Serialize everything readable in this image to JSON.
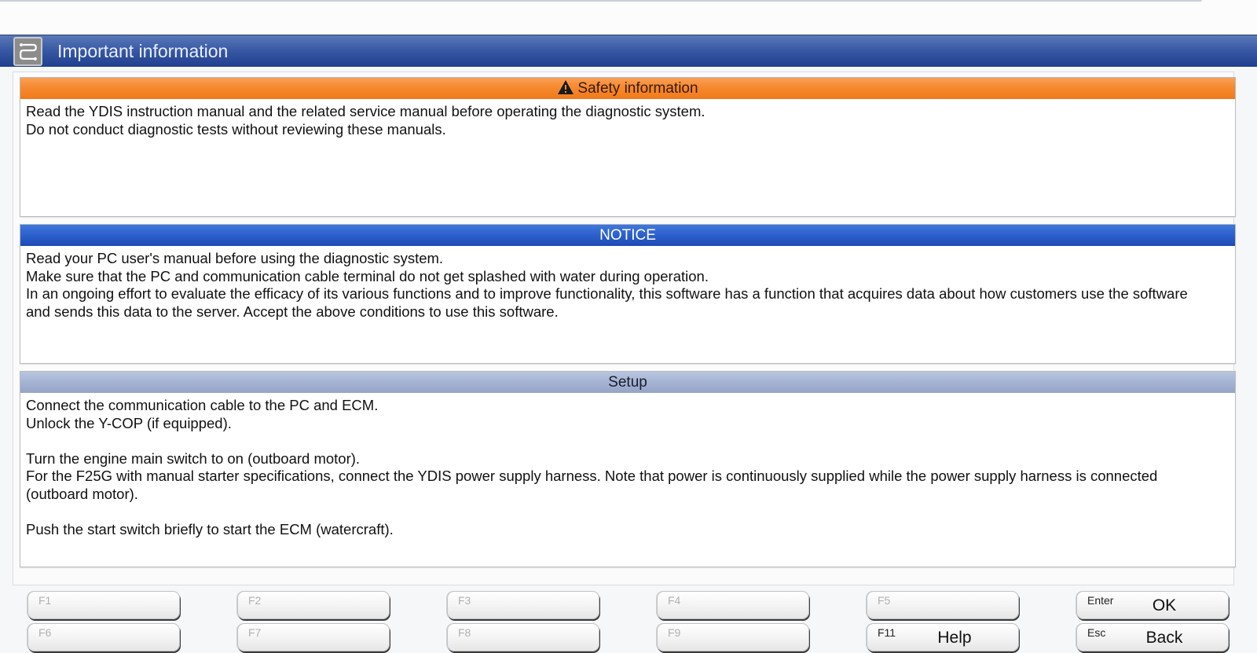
{
  "window": {
    "title": "Important information",
    "icon": "app-logo-icon"
  },
  "panels": {
    "safety": {
      "header": "Safety information",
      "header_icon": "warning-triangle-icon",
      "color": "#f58a2e",
      "lines": [
        "Read the YDIS instruction manual and the related service manual before operating the diagnostic system.",
        "Do not conduct diagnostic tests without reviewing these manuals."
      ]
    },
    "notice": {
      "header": "NOTICE",
      "color": "#2c5fcb",
      "lines": [
        "Read your PC user's manual before using the diagnostic system.",
        "Make sure that the PC and communication cable terminal do not get splashed with water during operation.",
        "In an ongoing effort to evaluate the efficacy of its various functions and to improve functionality, this software has a function that acquires data about how customers use the software and sends this data to the server. Accept the above conditions to use this software."
      ]
    },
    "setup": {
      "header": "Setup",
      "color": "#a5b3d3",
      "lines": [
        "Connect the communication cable to the PC and ECM.",
        "Unlock the Y-COP (if equipped).",
        "",
        "Turn the engine main switch to on (outboard motor).",
        "For the F25G with manual starter specifications, connect the YDIS power supply harness. Note that power is continuously supplied while the power supply harness is connected (outboard motor).",
        "",
        "Push the start switch briefly to start the ECM (watercraft)."
      ]
    }
  },
  "function_keys": [
    {
      "key": "F1",
      "label": "",
      "enabled": false
    },
    {
      "key": "F2",
      "label": "",
      "enabled": false
    },
    {
      "key": "F3",
      "label": "",
      "enabled": false
    },
    {
      "key": "F4",
      "label": "",
      "enabled": false
    },
    {
      "key": "F5",
      "label": "",
      "enabled": false
    },
    {
      "key": "Enter",
      "label": "OK",
      "enabled": true
    },
    {
      "key": "F6",
      "label": "",
      "enabled": false
    },
    {
      "key": "F7",
      "label": "",
      "enabled": false
    },
    {
      "key": "F8",
      "label": "",
      "enabled": false
    },
    {
      "key": "F9",
      "label": "",
      "enabled": false
    },
    {
      "key": "F11",
      "label": "Help",
      "enabled": true
    },
    {
      "key": "Esc",
      "label": "Back",
      "enabled": true
    }
  ]
}
